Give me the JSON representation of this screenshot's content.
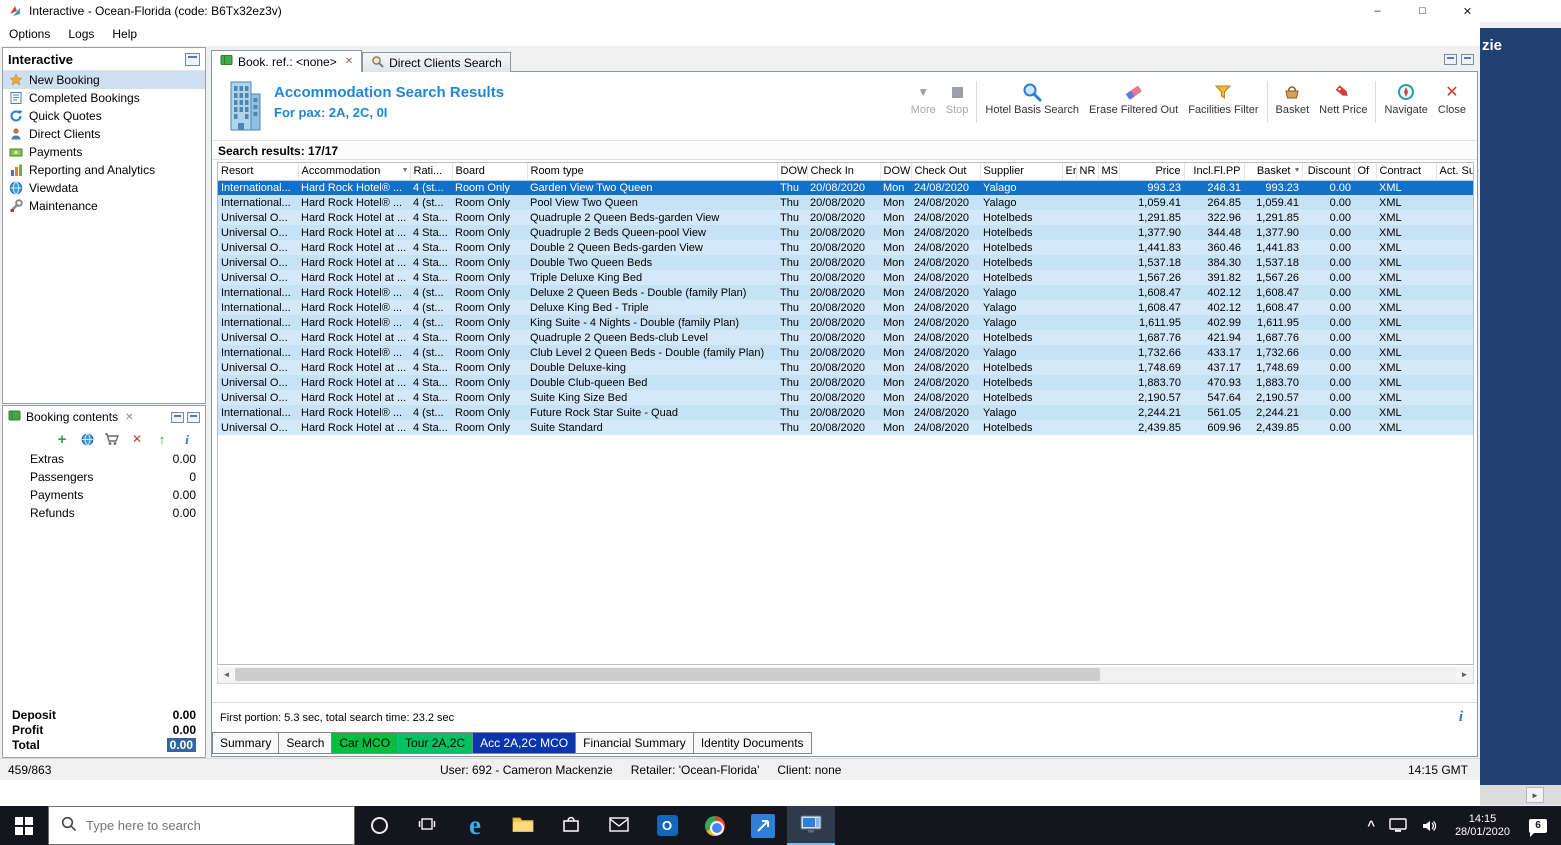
{
  "window": {
    "title": "Interactive - Ocean-Florida (code: B6Tx32ez3v)"
  },
  "background_window": {
    "title_fragment": "zie"
  },
  "menubar": {
    "items": [
      "Options",
      "Logs",
      "Help"
    ]
  },
  "sidebar": {
    "title": "Interactive",
    "items": [
      {
        "label": "New Booking",
        "icon": "new-booking-icon",
        "selected": true
      },
      {
        "label": "Completed Bookings",
        "icon": "completed-bookings-icon"
      },
      {
        "label": "Quick Quotes",
        "icon": "quick-quotes-icon"
      },
      {
        "label": "Direct Clients",
        "icon": "direct-clients-icon"
      },
      {
        "label": "Payments",
        "icon": "payments-icon"
      },
      {
        "label": "Reporting and Analytics",
        "icon": "reporting-analytics-icon"
      },
      {
        "label": "Viewdata",
        "icon": "viewdata-icon"
      },
      {
        "label": "Maintenance",
        "icon": "maintenance-icon"
      }
    ]
  },
  "booking_contents": {
    "title": "Booking contents",
    "toolbar_icons": [
      "add-icon",
      "web-icon",
      "cart-icon",
      "delete-icon",
      "upload-icon",
      "info-icon"
    ],
    "rows": [
      {
        "label": "Extras",
        "value": "0.00"
      },
      {
        "label": "Passengers",
        "value": "0"
      },
      {
        "label": "Payments",
        "value": "0.00"
      },
      {
        "label": "Refunds",
        "value": "0.00"
      }
    ],
    "totals": [
      {
        "label": "Deposit",
        "value": "0.00"
      },
      {
        "label": "Profit",
        "value": "0.00"
      },
      {
        "label": "Total",
        "value": "0.00",
        "highlighted": true
      }
    ]
  },
  "tabs": [
    {
      "label": "Book. ref.: <none>",
      "active": true,
      "closable": true
    },
    {
      "label": "Direct Clients Search",
      "active": false
    }
  ],
  "results_header": {
    "title": "Accommodation Search Results",
    "subtitle": "For pax: 2A, 2C, 0I"
  },
  "toolbar": {
    "buttons": [
      {
        "label": "More",
        "icon": "more-icon",
        "disabled": true
      },
      {
        "label": "Stop",
        "icon": "stop-icon",
        "disabled": true
      },
      {
        "label": "Hotel Basis Search",
        "icon": "hotel-basis-search-icon"
      },
      {
        "label": "Erase Filtered Out",
        "icon": "erase-filtered-out-icon"
      },
      {
        "label": "Facilities Filter",
        "icon": "facilities-filter-icon"
      },
      {
        "label": "Basket",
        "icon": "basket-icon"
      },
      {
        "label": "Nett Price",
        "icon": "nett-price-icon"
      },
      {
        "label": "Navigate",
        "icon": "navigate-icon"
      },
      {
        "label": "Close",
        "icon": "close-icon"
      }
    ]
  },
  "results_count": "Search results: 17/17",
  "table": {
    "selected_row": 0,
    "columns": [
      {
        "label": "Resort"
      },
      {
        "label": "Accommodation",
        "icon": "filter-icon"
      },
      {
        "label": "Rati..."
      },
      {
        "label": "Board"
      },
      {
        "label": "Room type"
      },
      {
        "label": "DOW"
      },
      {
        "label": "Check In"
      },
      {
        "label": "DOW"
      },
      {
        "label": "Check Out"
      },
      {
        "label": "Supplier"
      },
      {
        "label": "Er"
      },
      {
        "label": "NR"
      },
      {
        "label": "MS"
      },
      {
        "label": "Price"
      },
      {
        "label": "Incl.Fl.PP"
      },
      {
        "label": "Basket",
        "icon": "sort-icon"
      },
      {
        "label": "Discount"
      },
      {
        "label": "Of"
      },
      {
        "label": "Contract"
      },
      {
        "label": "Act. Su..."
      }
    ],
    "rows": [
      [
        "International...",
        "Hard Rock Hotel® ...",
        "4 (st...",
        "Room Only",
        "Garden View Two Queen",
        "Thu",
        "20/08/2020",
        "Mon",
        "24/08/2020",
        "Yalago",
        "",
        "",
        "",
        "993.23",
        "248.31",
        "993.23",
        "0.00",
        "",
        "XML",
        ""
      ],
      [
        "International...",
        "Hard Rock Hotel® ...",
        "4 (st...",
        "Room Only",
        "Pool View Two Queen",
        "Thu",
        "20/08/2020",
        "Mon",
        "24/08/2020",
        "Yalago",
        "",
        "",
        "",
        "1,059.41",
        "264.85",
        "1,059.41",
        "0.00",
        "",
        "XML",
        ""
      ],
      [
        "Universal O...",
        "Hard Rock Hotel at ...",
        "4 Sta...",
        "Room Only",
        "Quadruple 2 Queen Beds-garden View",
        "Thu",
        "20/08/2020",
        "Mon",
        "24/08/2020",
        "Hotelbeds",
        "",
        "",
        "",
        "1,291.85",
        "322.96",
        "1,291.85",
        "0.00",
        "",
        "XML",
        ""
      ],
      [
        "Universal O...",
        "Hard Rock Hotel at ...",
        "4 Sta...",
        "Room Only",
        "Quadruple 2 Beds Queen-pool View",
        "Thu",
        "20/08/2020",
        "Mon",
        "24/08/2020",
        "Hotelbeds",
        "",
        "",
        "",
        "1,377.90",
        "344.48",
        "1,377.90",
        "0.00",
        "",
        "XML",
        ""
      ],
      [
        "Universal O...",
        "Hard Rock Hotel at ...",
        "4 Sta...",
        "Room Only",
        "Double 2 Queen Beds-garden View",
        "Thu",
        "20/08/2020",
        "Mon",
        "24/08/2020",
        "Hotelbeds",
        "",
        "",
        "",
        "1,441.83",
        "360.46",
        "1,441.83",
        "0.00",
        "",
        "XML",
        ""
      ],
      [
        "Universal O...",
        "Hard Rock Hotel at ...",
        "4 Sta...",
        "Room Only",
        "Double Two Queen Beds",
        "Thu",
        "20/08/2020",
        "Mon",
        "24/08/2020",
        "Hotelbeds",
        "",
        "",
        "",
        "1,537.18",
        "384.30",
        "1,537.18",
        "0.00",
        "",
        "XML",
        ""
      ],
      [
        "Universal O...",
        "Hard Rock Hotel at ...",
        "4 Sta...",
        "Room Only",
        "Triple Deluxe King Bed",
        "Thu",
        "20/08/2020",
        "Mon",
        "24/08/2020",
        "Hotelbeds",
        "",
        "",
        "",
        "1,567.26",
        "391.82",
        "1,567.26",
        "0.00",
        "",
        "XML",
        ""
      ],
      [
        "International...",
        "Hard Rock Hotel® ...",
        "4 (st...",
        "Room Only",
        "Deluxe 2 Queen Beds - Double (family Plan)",
        "Thu",
        "20/08/2020",
        "Mon",
        "24/08/2020",
        "Yalago",
        "",
        "",
        "",
        "1,608.47",
        "402.12",
        "1,608.47",
        "0.00",
        "",
        "XML",
        ""
      ],
      [
        "International...",
        "Hard Rock Hotel® ...",
        "4 (st...",
        "Room Only",
        "Deluxe King Bed - Triple",
        "Thu",
        "20/08/2020",
        "Mon",
        "24/08/2020",
        "Yalago",
        "",
        "",
        "",
        "1,608.47",
        "402.12",
        "1,608.47",
        "0.00",
        "",
        "XML",
        ""
      ],
      [
        "International...",
        "Hard Rock Hotel® ...",
        "4 (st...",
        "Room Only",
        "King Suite - 4 Nights - Double (family Plan)",
        "Thu",
        "20/08/2020",
        "Mon",
        "24/08/2020",
        "Yalago",
        "",
        "",
        "",
        "1,611.95",
        "402.99",
        "1,611.95",
        "0.00",
        "",
        "XML",
        ""
      ],
      [
        "Universal O...",
        "Hard Rock Hotel at ...",
        "4 Sta...",
        "Room Only",
        "Quadruple 2 Queen Beds-club Level",
        "Thu",
        "20/08/2020",
        "Mon",
        "24/08/2020",
        "Hotelbeds",
        "",
        "",
        "",
        "1,687.76",
        "421.94",
        "1,687.76",
        "0.00",
        "",
        "XML",
        ""
      ],
      [
        "International...",
        "Hard Rock Hotel® ...",
        "4 (st...",
        "Room Only",
        "Club Level 2 Queen Beds - Double (family Plan)",
        "Thu",
        "20/08/2020",
        "Mon",
        "24/08/2020",
        "Yalago",
        "",
        "",
        "",
        "1,732.66",
        "433.17",
        "1,732.66",
        "0.00",
        "",
        "XML",
        ""
      ],
      [
        "Universal O...",
        "Hard Rock Hotel at ...",
        "4 Sta...",
        "Room Only",
        "Double Deluxe-king",
        "Thu",
        "20/08/2020",
        "Mon",
        "24/08/2020",
        "Hotelbeds",
        "",
        "",
        "",
        "1,748.69",
        "437.17",
        "1,748.69",
        "0.00",
        "",
        "XML",
        ""
      ],
      [
        "Universal O...",
        "Hard Rock Hotel at ...",
        "4 Sta...",
        "Room Only",
        "Double Club-queen Bed",
        "Thu",
        "20/08/2020",
        "Mon",
        "24/08/2020",
        "Hotelbeds",
        "",
        "",
        "",
        "1,883.70",
        "470.93",
        "1,883.70",
        "0.00",
        "",
        "XML",
        ""
      ],
      [
        "Universal O...",
        "Hard Rock Hotel at ...",
        "4 Sta...",
        "Room Only",
        "Suite King Size Bed",
        "Thu",
        "20/08/2020",
        "Mon",
        "24/08/2020",
        "Hotelbeds",
        "",
        "",
        "",
        "2,190.57",
        "547.64",
        "2,190.57",
        "0.00",
        "",
        "XML",
        ""
      ],
      [
        "International...",
        "Hard Rock Hotel® ...",
        "4 (st...",
        "Room Only",
        "Future Rock Star Suite - Quad",
        "Thu",
        "20/08/2020",
        "Mon",
        "24/08/2020",
        "Yalago",
        "",
        "",
        "",
        "2,244.21",
        "561.05",
        "2,244.21",
        "0.00",
        "",
        "XML",
        ""
      ],
      [
        "Universal O...",
        "Hard Rock Hotel at ...",
        "4 Sta...",
        "Room Only",
        "Suite Standard",
        "Thu",
        "20/08/2020",
        "Mon",
        "24/08/2020",
        "Hotelbeds",
        "",
        "",
        "",
        "2,439.85",
        "609.96",
        "2,439.85",
        "0.00",
        "",
        "XML",
        ""
      ]
    ]
  },
  "status_line": "First portion: 5.3 sec, total search time: 23.2 sec",
  "bottom_tabs": [
    {
      "label": "Summary"
    },
    {
      "label": "Search"
    },
    {
      "label": "Car MCO",
      "color": "#00bf3f"
    },
    {
      "label": "Tour 2A,2C",
      "color": "#00c161"
    },
    {
      "label": "Acc 2A,2C MCO",
      "color": "#0a35ad",
      "active": true
    },
    {
      "label": "Financial Summary"
    },
    {
      "label": "Identity Documents"
    }
  ],
  "statusbar": {
    "left": "459/863",
    "user": "User: 692 - Cameron Mackenzie",
    "retailer": "Retailer: 'Ocean-Florida'",
    "client": "Client: none",
    "right": "14:15 GMT"
  },
  "taskbar": {
    "search_placeholder": "Type here to search",
    "time": "14:15",
    "date": "28/01/2020",
    "notification_badge": "6"
  },
  "colors": {
    "header_blue": "#1e87d3",
    "selected_row_blue": "#1170c8",
    "row_light_blue": "#d3e9f9",
    "row_alt_blue": "#c7e2f5",
    "car_tab_green": "#00bf3f",
    "tour_tab_green": "#00c161",
    "acc_tab_navy": "#0a35ad"
  }
}
